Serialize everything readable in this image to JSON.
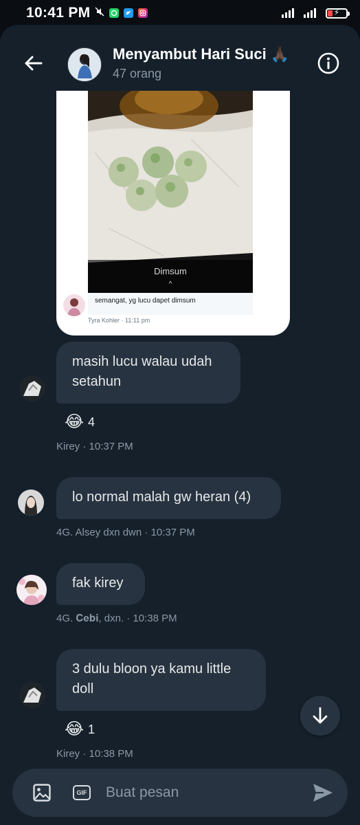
{
  "status_bar": {
    "time": "10:41 PM",
    "icons": [
      "mute-icon",
      "whatsapp-icon",
      "twitter-icon",
      "instagram-icon",
      "wifi-signal-icon",
      "cell-signal-icon",
      "battery-charging-icon"
    ]
  },
  "header": {
    "title": "Menyambut Hari Suci",
    "title_emoji": "🙏🏿",
    "subtitle": "47 orang"
  },
  "image_message": {
    "caption": "Dimsum",
    "comment": "semangat, yg lucu dapet dimsum",
    "meta": "Tyra Kohler · 11:11 pm"
  },
  "messages": [
    {
      "text_lines": [
        "masih lucu walau udah",
        "setahun"
      ],
      "reaction": {
        "emoji": "😂",
        "count": "4"
      },
      "meta": "Kirey · 10:37 PM"
    },
    {
      "text_lines": [
        "lo normal malah gw heran (4)"
      ],
      "meta": "4G. Alsey dxn dwn · 10:37 PM"
    },
    {
      "text_lines": [
        "fak kirey"
      ],
      "meta": "4G. 𝐂𝐞𝐛𝐢, dxn. · 10:38 PM"
    },
    {
      "text_lines": [
        "3 dulu bloon ya kamu little",
        "doll"
      ],
      "reaction": {
        "emoji": "😂",
        "count": "1"
      },
      "meta": "Kirey · 10:38 PM"
    }
  ],
  "composer": {
    "placeholder": "Buat pesan",
    "gif_label": "GIF"
  },
  "colors": {
    "background": "#15202b",
    "bubble": "#273340",
    "secondary_text": "#8b98a5",
    "accent": "#1d9bf0"
  }
}
